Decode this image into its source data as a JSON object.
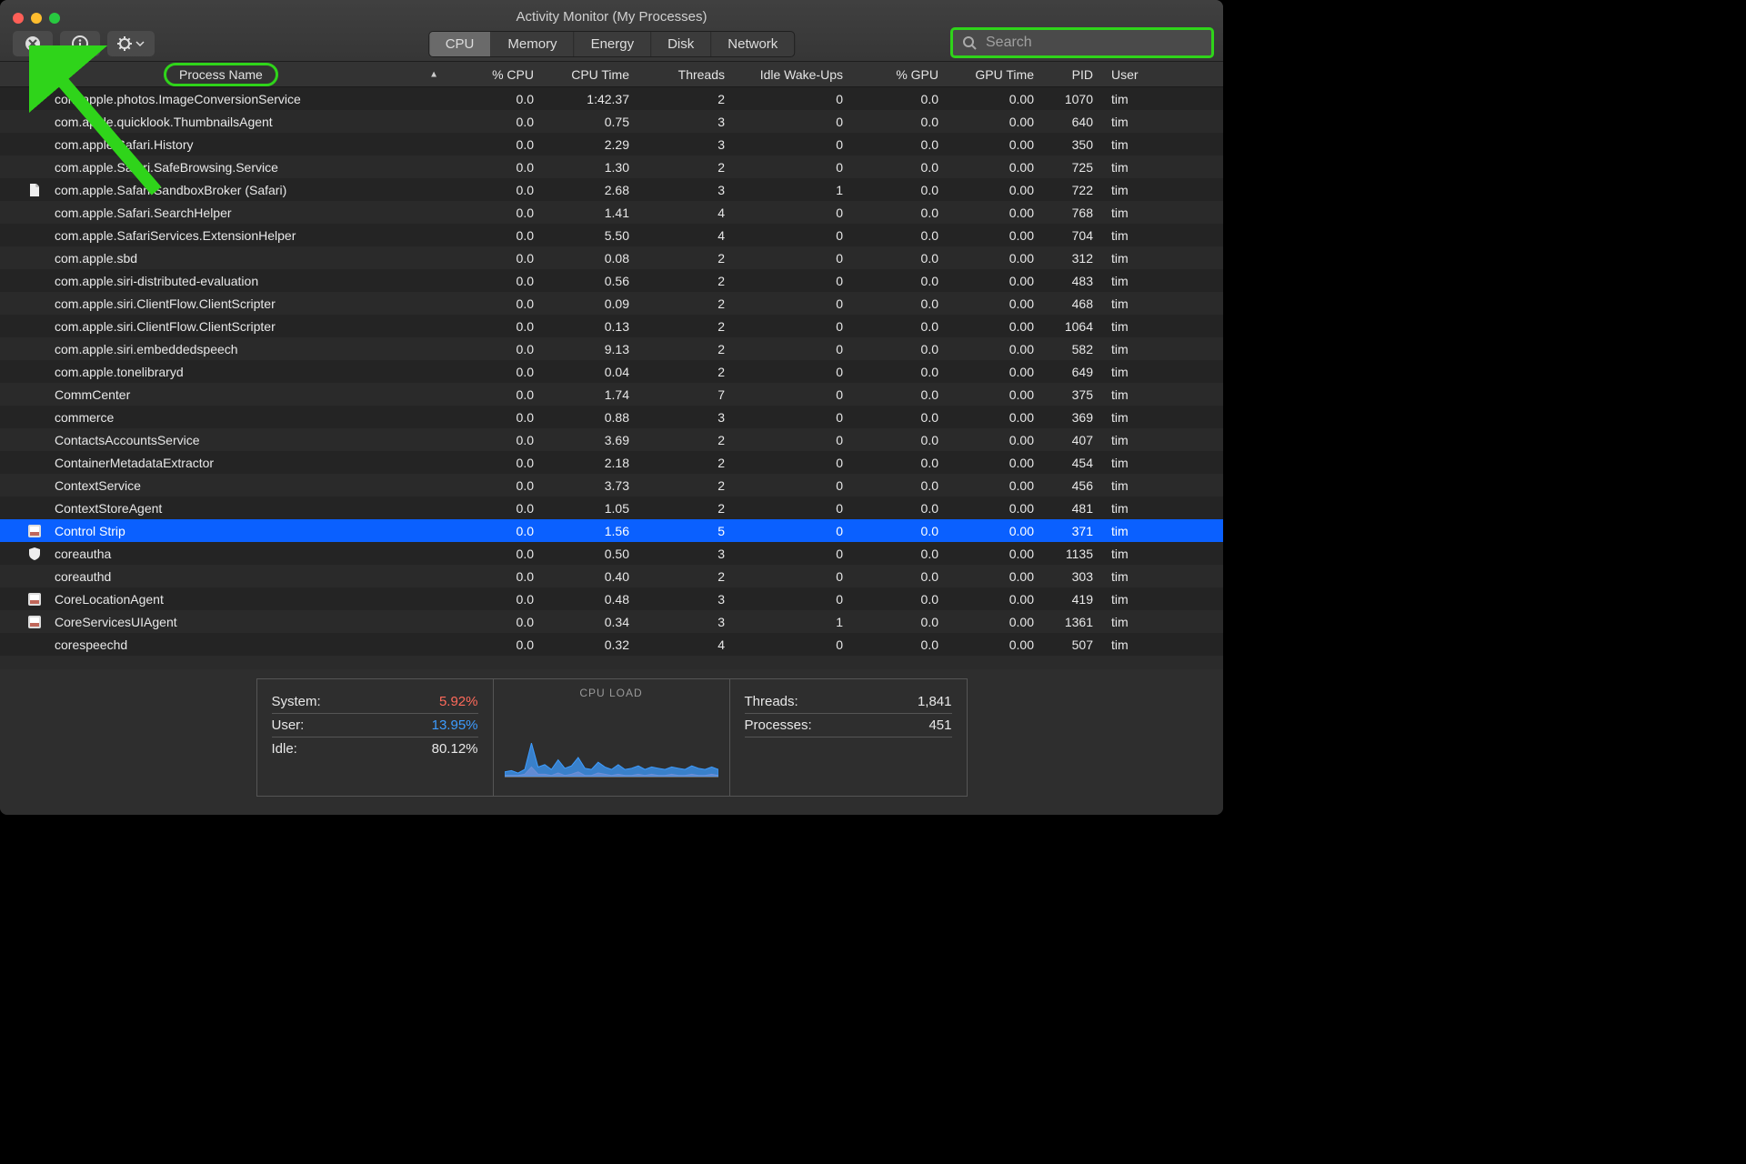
{
  "window_title": "Activity Monitor (My Processes)",
  "toolbar": {
    "stop_title": "Stop process",
    "info_title": "Info",
    "gear_title": "Options"
  },
  "search": {
    "placeholder": "Search"
  },
  "tabs": [
    "CPU",
    "Memory",
    "Energy",
    "Disk",
    "Network"
  ],
  "active_tab": 0,
  "columns": [
    "Process Name",
    "% CPU",
    "CPU Time",
    "Threads",
    "Idle Wake-Ups",
    "% GPU",
    "GPU Time",
    "PID",
    "User"
  ],
  "rows": [
    {
      "icon": "",
      "name": "com.apple.photos.ImageConversionService",
      "cpu": "0.0",
      "time": "1:42.37",
      "th": "2",
      "wake": "0",
      "gpu": "0.0",
      "gt": "0.00",
      "pid": "1070",
      "user": "tim"
    },
    {
      "icon": "",
      "name": "com.apple.quicklook.ThumbnailsAgent",
      "cpu": "0.0",
      "time": "0.75",
      "th": "3",
      "wake": "0",
      "gpu": "0.0",
      "gt": "0.00",
      "pid": "640",
      "user": "tim"
    },
    {
      "icon": "",
      "name": "com.apple.Safari.History",
      "cpu": "0.0",
      "time": "2.29",
      "th": "3",
      "wake": "0",
      "gpu": "0.0",
      "gt": "0.00",
      "pid": "350",
      "user": "tim"
    },
    {
      "icon": "",
      "name": "com.apple.Safari.SafeBrowsing.Service",
      "cpu": "0.0",
      "time": "1.30",
      "th": "2",
      "wake": "0",
      "gpu": "0.0",
      "gt": "0.00",
      "pid": "725",
      "user": "tim"
    },
    {
      "icon": "doc",
      "name": "com.apple.Safari.SandboxBroker (Safari)",
      "cpu": "0.0",
      "time": "2.68",
      "th": "3",
      "wake": "1",
      "gpu": "0.0",
      "gt": "0.00",
      "pid": "722",
      "user": "tim"
    },
    {
      "icon": "",
      "name": "com.apple.Safari.SearchHelper",
      "cpu": "0.0",
      "time": "1.41",
      "th": "4",
      "wake": "0",
      "gpu": "0.0",
      "gt": "0.00",
      "pid": "768",
      "user": "tim"
    },
    {
      "icon": "",
      "name": "com.apple.SafariServices.ExtensionHelper",
      "cpu": "0.0",
      "time": "5.50",
      "th": "4",
      "wake": "0",
      "gpu": "0.0",
      "gt": "0.00",
      "pid": "704",
      "user": "tim"
    },
    {
      "icon": "",
      "name": "com.apple.sbd",
      "cpu": "0.0",
      "time": "0.08",
      "th": "2",
      "wake": "0",
      "gpu": "0.0",
      "gt": "0.00",
      "pid": "312",
      "user": "tim"
    },
    {
      "icon": "",
      "name": "com.apple.siri-distributed-evaluation",
      "cpu": "0.0",
      "time": "0.56",
      "th": "2",
      "wake": "0",
      "gpu": "0.0",
      "gt": "0.00",
      "pid": "483",
      "user": "tim"
    },
    {
      "icon": "",
      "name": "com.apple.siri.ClientFlow.ClientScripter",
      "cpu": "0.0",
      "time": "0.09",
      "th": "2",
      "wake": "0",
      "gpu": "0.0",
      "gt": "0.00",
      "pid": "468",
      "user": "tim"
    },
    {
      "icon": "",
      "name": "com.apple.siri.ClientFlow.ClientScripter",
      "cpu": "0.0",
      "time": "0.13",
      "th": "2",
      "wake": "0",
      "gpu": "0.0",
      "gt": "0.00",
      "pid": "1064",
      "user": "tim"
    },
    {
      "icon": "",
      "name": "com.apple.siri.embeddedspeech",
      "cpu": "0.0",
      "time": "9.13",
      "th": "2",
      "wake": "0",
      "gpu": "0.0",
      "gt": "0.00",
      "pid": "582",
      "user": "tim"
    },
    {
      "icon": "",
      "name": "com.apple.tonelibraryd",
      "cpu": "0.0",
      "time": "0.04",
      "th": "2",
      "wake": "0",
      "gpu": "0.0",
      "gt": "0.00",
      "pid": "649",
      "user": "tim"
    },
    {
      "icon": "",
      "name": "CommCenter",
      "cpu": "0.0",
      "time": "1.74",
      "th": "7",
      "wake": "0",
      "gpu": "0.0",
      "gt": "0.00",
      "pid": "375",
      "user": "tim"
    },
    {
      "icon": "",
      "name": "commerce",
      "cpu": "0.0",
      "time": "0.88",
      "th": "3",
      "wake": "0",
      "gpu": "0.0",
      "gt": "0.00",
      "pid": "369",
      "user": "tim"
    },
    {
      "icon": "",
      "name": "ContactsAccountsService",
      "cpu": "0.0",
      "time": "3.69",
      "th": "2",
      "wake": "0",
      "gpu": "0.0",
      "gt": "0.00",
      "pid": "407",
      "user": "tim"
    },
    {
      "icon": "",
      "name": "ContainerMetadataExtractor",
      "cpu": "0.0",
      "time": "2.18",
      "th": "2",
      "wake": "0",
      "gpu": "0.0",
      "gt": "0.00",
      "pid": "454",
      "user": "tim"
    },
    {
      "icon": "",
      "name": "ContextService",
      "cpu": "0.0",
      "time": "3.73",
      "th": "2",
      "wake": "0",
      "gpu": "0.0",
      "gt": "0.00",
      "pid": "456",
      "user": "tim"
    },
    {
      "icon": "",
      "name": "ContextStoreAgent",
      "cpu": "0.0",
      "time": "1.05",
      "th": "2",
      "wake": "0",
      "gpu": "0.0",
      "gt": "0.00",
      "pid": "481",
      "user": "tim"
    },
    {
      "icon": "app",
      "name": "Control Strip",
      "cpu": "0.0",
      "time": "1.56",
      "th": "5",
      "wake": "0",
      "gpu": "0.0",
      "gt": "0.00",
      "pid": "371",
      "user": "tim",
      "selected": true
    },
    {
      "icon": "shield",
      "name": "coreautha",
      "cpu": "0.0",
      "time": "0.50",
      "th": "3",
      "wake": "0",
      "gpu": "0.0",
      "gt": "0.00",
      "pid": "1135",
      "user": "tim"
    },
    {
      "icon": "",
      "name": "coreauthd",
      "cpu": "0.0",
      "time": "0.40",
      "th": "2",
      "wake": "0",
      "gpu": "0.0",
      "gt": "0.00",
      "pid": "303",
      "user": "tim"
    },
    {
      "icon": "app",
      "name": "CoreLocationAgent",
      "cpu": "0.0",
      "time": "0.48",
      "th": "3",
      "wake": "0",
      "gpu": "0.0",
      "gt": "0.00",
      "pid": "419",
      "user": "tim"
    },
    {
      "icon": "app",
      "name": "CoreServicesUIAgent",
      "cpu": "0.0",
      "time": "0.34",
      "th": "3",
      "wake": "1",
      "gpu": "0.0",
      "gt": "0.00",
      "pid": "1361",
      "user": "tim"
    },
    {
      "icon": "",
      "name": "corespeechd",
      "cpu": "0.0",
      "time": "0.32",
      "th": "4",
      "wake": "0",
      "gpu": "0.0",
      "gt": "0.00",
      "pid": "507",
      "user": "tim"
    }
  ],
  "footer": {
    "system_label": "System:",
    "system_val": "5.92%",
    "user_label": "User:",
    "user_val": "13.95%",
    "idle_label": "Idle:",
    "idle_val": "80.12%",
    "chart_title": "CPU LOAD",
    "threads_label": "Threads:",
    "threads_val": "1,841",
    "procs_label": "Processes:",
    "procs_val": "451"
  },
  "chart_data": {
    "type": "area",
    "title": "CPU LOAD",
    "series": [
      {
        "name": "User",
        "color": "#3d9cff",
        "values": [
          4,
          5,
          3,
          6,
          28,
          8,
          10,
          6,
          14,
          7,
          9,
          16,
          7,
          6,
          12,
          8,
          6,
          10,
          6,
          7,
          9,
          6,
          8,
          7,
          6,
          8,
          7,
          6,
          9,
          7,
          6,
          8,
          6
        ]
      },
      {
        "name": "System",
        "color": "#ff6a5b",
        "values": [
          1,
          1,
          1,
          2,
          8,
          2,
          2,
          1,
          3,
          1,
          2,
          4,
          1,
          1,
          3,
          2,
          1,
          2,
          1,
          1,
          2,
          1,
          2,
          1,
          1,
          2,
          1,
          1,
          2,
          1,
          1,
          2,
          1
        ]
      }
    ],
    "ylim": [
      0,
      60
    ]
  }
}
